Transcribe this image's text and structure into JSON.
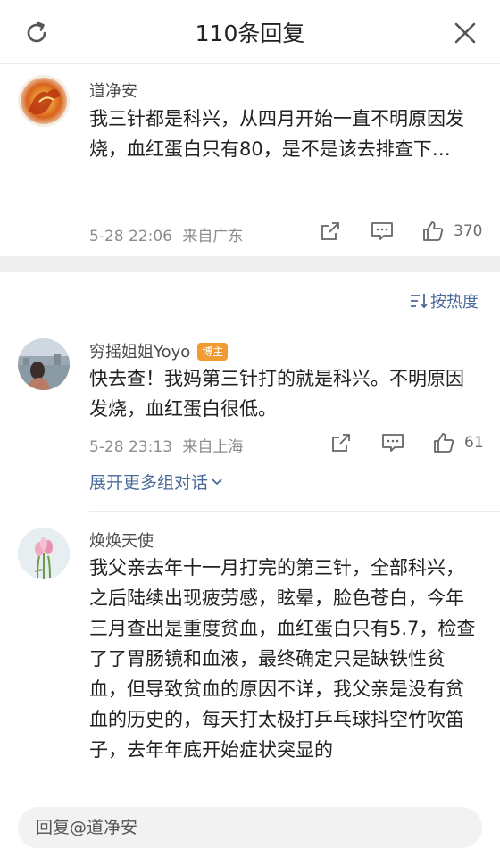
{
  "header": {
    "title": "110条回复",
    "refresh_icon": "refresh-icon",
    "close_icon": "close-icon"
  },
  "comments": [
    {
      "username": "道净安",
      "avatar_icon": "phoenix-avatar",
      "content": "我三针都是科兴，从四月开始一直不明原因发烧，血红蛋白只有80，是不是该去排查下…",
      "time": "5-28 22:06",
      "location": "来自广东",
      "likes": "370"
    },
    {
      "username": "穷摇姐姐Yoyo",
      "badge": "博主",
      "avatar_icon": "user-photo-avatar",
      "content": "快去查！我妈第三针打的就是科兴。不明原因发烧，血红蛋白很低。",
      "time": "5-28 23:13",
      "location": "来自上海",
      "likes": "61",
      "expand_label": "展开更多组对话"
    },
    {
      "username": "焕焕天使",
      "avatar_icon": "tulip-avatar",
      "content": "我父亲去年十一月打完的第三针，全部科兴，之后陆续出现疲劳感，眩晕，脸色苍白，今年三月查出是重度贫血，血红蛋白只有5.7，检查了了胃肠镜和血液，最终确定只是缺铁性贫血，但导致贫血的原因不详，我父亲是没有贫血的历史的，每天打太极打乒乓球抖空竹吹笛子，去年年底开始症状突显的"
    }
  ],
  "sort": {
    "label": "按热度"
  },
  "reply_bar": {
    "placeholder": "回复@道净安"
  },
  "colors": {
    "link": "#4a6a99",
    "badge": "#f29b33",
    "separator": "#efefef"
  }
}
